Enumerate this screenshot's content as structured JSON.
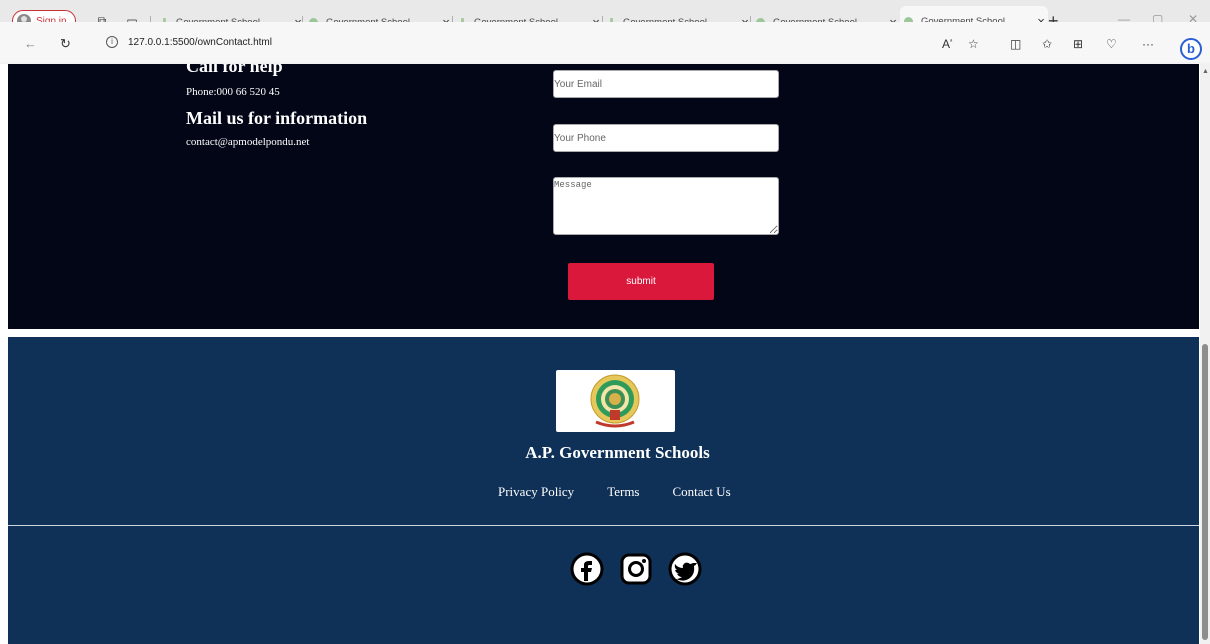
{
  "browser": {
    "sign_in": "Sign in",
    "tabs": [
      {
        "title": "Government School",
        "close": "×"
      },
      {
        "title": "Government School",
        "close": "×"
      },
      {
        "title": "Government School",
        "close": "×"
      },
      {
        "title": "Government School",
        "close": "×"
      },
      {
        "title": "Government School",
        "close": "×"
      },
      {
        "title": "Government School",
        "close": "×"
      }
    ],
    "new_tab": "+",
    "url": "127.0.0.1:5500/ownContact.html"
  },
  "contact": {
    "help_heading": "Call for help",
    "phone": "Phone:000 66 520 45",
    "mail_heading": "Mail us for information",
    "email": "contact@apmodelpondu.net"
  },
  "form": {
    "email_placeholder": "Your Email",
    "phone_placeholder": "Your Phone",
    "message_placeholder": "Message",
    "submit_label": "submit"
  },
  "footer": {
    "title": "A.P. Government Schools",
    "links": [
      "Privacy Policy",
      "Terms",
      "Contact Us"
    ],
    "social_icons": [
      "facebook-icon",
      "instagram-icon",
      "twitter-icon"
    ]
  },
  "colors": {
    "dark_section": "#020617",
    "footer": "#0f3057",
    "submit": "#d9183b"
  }
}
